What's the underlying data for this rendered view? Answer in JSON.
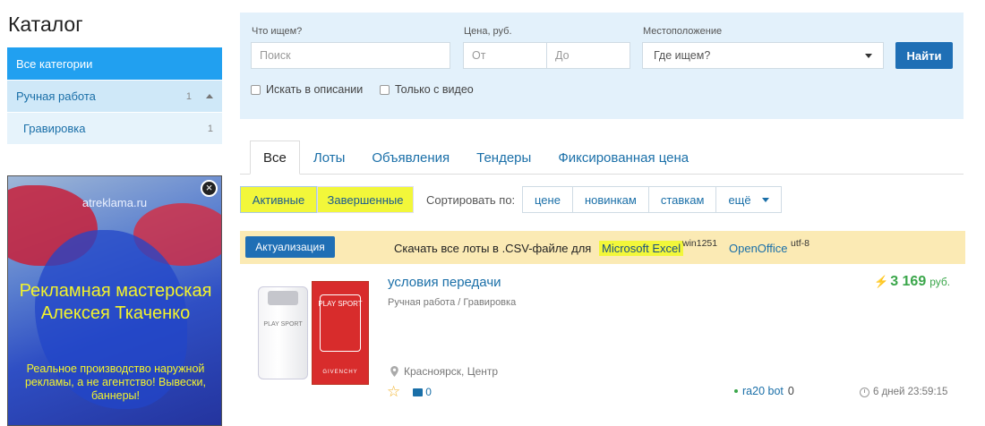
{
  "sidebar": {
    "title": "Каталог",
    "all_categories": "Все категории",
    "category": {
      "label": "Ручная работа",
      "count": "1"
    },
    "subcategory": {
      "label": "Гравировка",
      "count": "1"
    }
  },
  "ad": {
    "site": "atreklama.ru",
    "headline": "Рекламная мастерская Алексея Ткаченко",
    "body": "Реальное производство наружной рекламы, а не агентство! Вывески, баннеры!",
    "close_icon": "close-icon"
  },
  "search": {
    "query_label": "Что ищем?",
    "query_placeholder": "Поиск",
    "price_label": "Цена, руб.",
    "price_from_placeholder": "От",
    "price_to_placeholder": "До",
    "location_label": "Местоположение",
    "location_value": "Где ищем?",
    "submit_label": "Найти",
    "check_description": "Искать в описании",
    "check_video": "Только с видео"
  },
  "tabs": [
    "Все",
    "Лоты",
    "Объявления",
    "Тендеры",
    "Фиксированная цена"
  ],
  "filters": {
    "active": "Активные",
    "finished": "Завершенные",
    "sort_label": "Сортировать по:",
    "sort_options": [
      "цене",
      "новинкам",
      "ставкам",
      "ещё"
    ],
    "highlight_color": "#f2f73a"
  },
  "export": {
    "button": "Актуализация",
    "text": "Скачать все лоты в .CSV-файле для",
    "excel": "Microsoft Excel",
    "excel_encoding": "win1251",
    "openoffice": "OpenOffice",
    "openoffice_encoding": "utf-8"
  },
  "listing": {
    "title": "условия передачи",
    "category_path": "Ручная работа / Гравировка",
    "price": "3 169",
    "currency": "руб.",
    "location": "Красноярск, Центр",
    "comments": "0",
    "seller": "ra20 bot",
    "seller_rating": "0",
    "time_left": "6 дней 23:59:15",
    "image": {
      "bottle_label": "PLAY SPORT",
      "box_label": "PLAY SPORT",
      "box_brand": "GIVENCHY"
    }
  }
}
